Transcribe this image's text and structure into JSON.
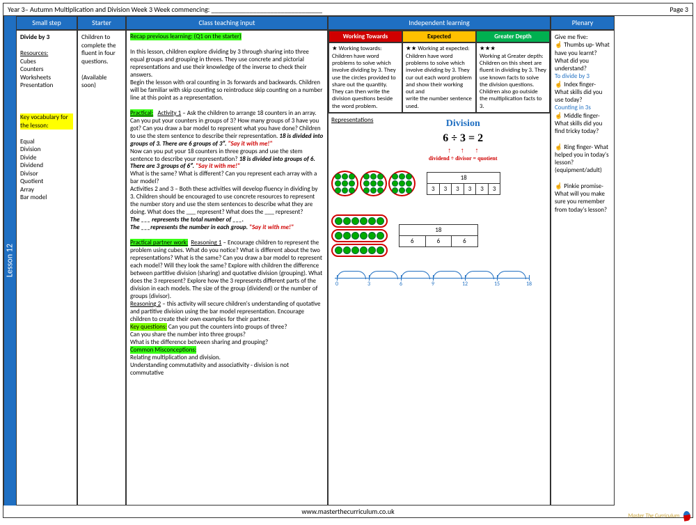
{
  "header": {
    "left": "Year 3– Autumn Multiplication and Division Week 3    Week commencing: ________________________________",
    "right": "Page 3"
  },
  "lesson_tab": "Lesson 12",
  "columns": {
    "smallstep": "Small step",
    "starter": "Starter",
    "teaching": "Class teaching input",
    "independent": "Independent learning",
    "plenary": "Plenary"
  },
  "smallstep": {
    "title": "Divide by 3",
    "resources_h": "Resources:",
    "resources": "Cubes\nCounters\nWorksheets\nPresentation",
    "vocab_h": "Key vocabulary for the lesson:",
    "vocab": "Equal\nDivision\nDivide\nDividend\nDivisor\nQuotient\nArray\nBar model"
  },
  "starter": {
    "p1": "Children to complete the fluent in four questions.",
    "p2": "(Available soon)"
  },
  "teaching": {
    "recap": "Recap previous learning: (Q1 on the starter)",
    "p1": "In this lesson, children explore dividing by 3 through sharing into three equal groups and grouping in threes.  They use concrete and pictorial representations and use their knowledge of the inverse to check their answers.",
    "p2": "Begin the lesson with oral counting in 3s forwards and backwards. Children will be familiar with skip counting so reintroduce skip counting on a number line at this point as a representation.",
    "practical_h": "Practical:",
    "act1_h": "Activity 1",
    "act1a": " – Ask the children to arrange 18 counters in an array.  Can you put your counters in groups of 3?  How many groups of 3 have you got?  Can you draw a bar model to represent  what you have done? Children to use the stem sentence to describe their representation. ",
    "stem1": "18 is divided into groups of 3. There are 6 groups of 3″. ",
    "say": "\"Say it with me!\"",
    "act1b": "Now can you put your 18 counters in three groups and use the stem sentence to describe your representation? ",
    "stem2": "18 is divided into groups of 6. There are 3 groups of 6″. ",
    "act1c": "What is the same? What is different?  Can you represent each array with a bar model?",
    "act23": "Activities 2 and 3 – Both these activities will develop fluency in dividing by 3. Children should be encouraged to use concrete resources to represent the number story and use the stem sentences to describe what they are doing. What does the ___ represent? What does the ___ represent?",
    "stem3": "The ___ represents the total number of ___.",
    "stem4": "The ___represents the number in each group. ",
    "partner_h": "Practical partner work:",
    "reason1_h": "Reasoning 1",
    "reason1": " – Encourage children to represent the problem using cubes. What do you notice? What is different about the two representations?  What is the same?    Can you draw a bar model to represent each model?  Will they look the same? Explore with children the difference between partitive division (sharing) and quotative division (grouping). What does the 3 represent?  Explore how the 3 represents different parts of the division in each models.  The size of the group (dividend)  or the number of groups (divisor).",
    "reason2_h": "Reasoning 2",
    "reason2": " – this activity will secure children's understanding of quotative and partitive division using the bar model representation. Encourage children to create their own examples for their partner.",
    "keyq_h": "Key questions:",
    "keyq": " Can you put the counters into groups of three?\nCan you share the number into three groups?\nWhat is the difference between sharing and grouping?",
    "misc_h": "Common Misconceptions:",
    "misc": "Relating multiplication and division.\nUnderstanding commutativity and associativity  - division is not commutative"
  },
  "independent": {
    "headers": {
      "wt": "Working Towards",
      "ex": "Expected",
      "gd": "Greater Depth"
    },
    "wt": {
      "stars": "★",
      "label": "  Working towards:",
      "body": "Children have word problems to solve which involve dividing by 3. They use the circles provided to share out the quantity. They can then write the division questions beside the word problem."
    },
    "ex": {
      "stars": "★★",
      "label": " Working at expected:",
      "body": "Children have word problems to solve which involve dividing by 3. They cur out each word problem and show their working out and\nwrite the number sentence used."
    },
    "gd": {
      "stars": "★★★",
      "label": "Working at Greater depth:",
      "body": "Children on this sheet are fluent in dividing by 3. They use known facts to solve the division questions. Children also go outside the multiplication facts to 3."
    },
    "reps_h": "Representations",
    "division": {
      "title": "Division",
      "eq": "6 ÷ 3 = 2",
      "labels": "dividend ÷ divisor =  quotient"
    },
    "bar18_6": {
      "total": "18",
      "parts": [
        "3",
        "3",
        "3",
        "3",
        "3",
        "3"
      ]
    },
    "bar18_3": {
      "total": "18",
      "parts": [
        "6",
        "6",
        "6"
      ]
    },
    "nl": [
      "0",
      "3",
      "6",
      "9",
      "12",
      "15",
      "18"
    ]
  },
  "plenary": {
    "title": "Give me five:",
    "thumbs": "☝ Thumbs up- What have you learnt? What did you understand?",
    "skill1": "To divide by 3",
    "index": "☝ Index finger- What skills did you use today?",
    "skill2": "Counting in 3s",
    "middle": "☝ Middle finger- What skills did you find tricky today?",
    "ring": "☝ Ring finger- What helped you in today's lesson? (equipment/adult)",
    "pinkie": "☝ Pinkie promise- What will you make sure you remember from today's lesson?"
  },
  "footer": "www.masterthecurriculum.co.uk",
  "logo": "Master The Curriculum"
}
